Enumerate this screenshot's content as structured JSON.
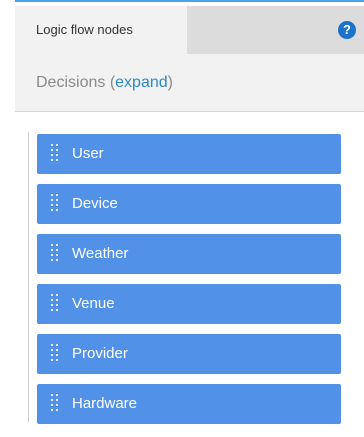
{
  "tabs": {
    "active_label": "Logic flow nodes",
    "help_icon": "help-circle-icon",
    "help_glyph": "?"
  },
  "section": {
    "label": "Decisions",
    "paren_open": "(",
    "expand_label": "expand",
    "paren_close": ")"
  },
  "nodes": [
    {
      "label": "User"
    },
    {
      "label": "Device"
    },
    {
      "label": "Weather"
    },
    {
      "label": "Venue"
    },
    {
      "label": "Provider"
    },
    {
      "label": "Hardware"
    }
  ],
  "colors": {
    "accent_border": "#4aa3f0",
    "node_fill": "#5192e8",
    "help_icon": "#1a73c8",
    "link": "#2a8ac8"
  }
}
